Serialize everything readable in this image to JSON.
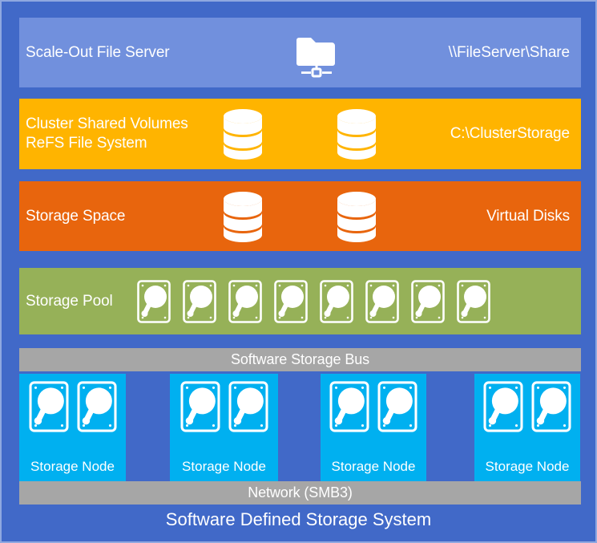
{
  "diagram": {
    "title": "Software Defined Storage System",
    "background_color": "#4169c8",
    "border_color": "#8fa8e0"
  },
  "layers": {
    "sofs": {
      "left_label": "Scale-Out File Server",
      "right_label": "\\\\FileServer\\Share",
      "color": "#7190dd",
      "icon": "shared-folder-icon"
    },
    "csv": {
      "left_label": "Cluster Shared Volumes\nReFS File System",
      "right_label": "C:\\ClusterStorage",
      "color": "#ffb400",
      "icon": "database-cylinder-icon",
      "icon_count": 2
    },
    "storage_space": {
      "left_label": "Storage Space",
      "right_label": "Virtual Disks",
      "color": "#e8650d",
      "icon": "database-cylinder-icon",
      "icon_count": 2
    },
    "storage_pool": {
      "left_label": "Storage Pool",
      "color": "#96b158",
      "icon": "hard-disk-icon",
      "icon_count": 8
    },
    "storage_bus": {
      "label": "Software Storage Bus",
      "color": "#a6a6a6"
    },
    "network": {
      "label": "Network (SMB3)",
      "color": "#a6a6a6"
    }
  },
  "nodes": {
    "color": "#00b0f0",
    "disks_per_node": 2,
    "items": [
      {
        "label": "Storage Node"
      },
      {
        "label": "Storage Node"
      },
      {
        "label": "Storage Node"
      },
      {
        "label": "Storage Node"
      }
    ]
  }
}
